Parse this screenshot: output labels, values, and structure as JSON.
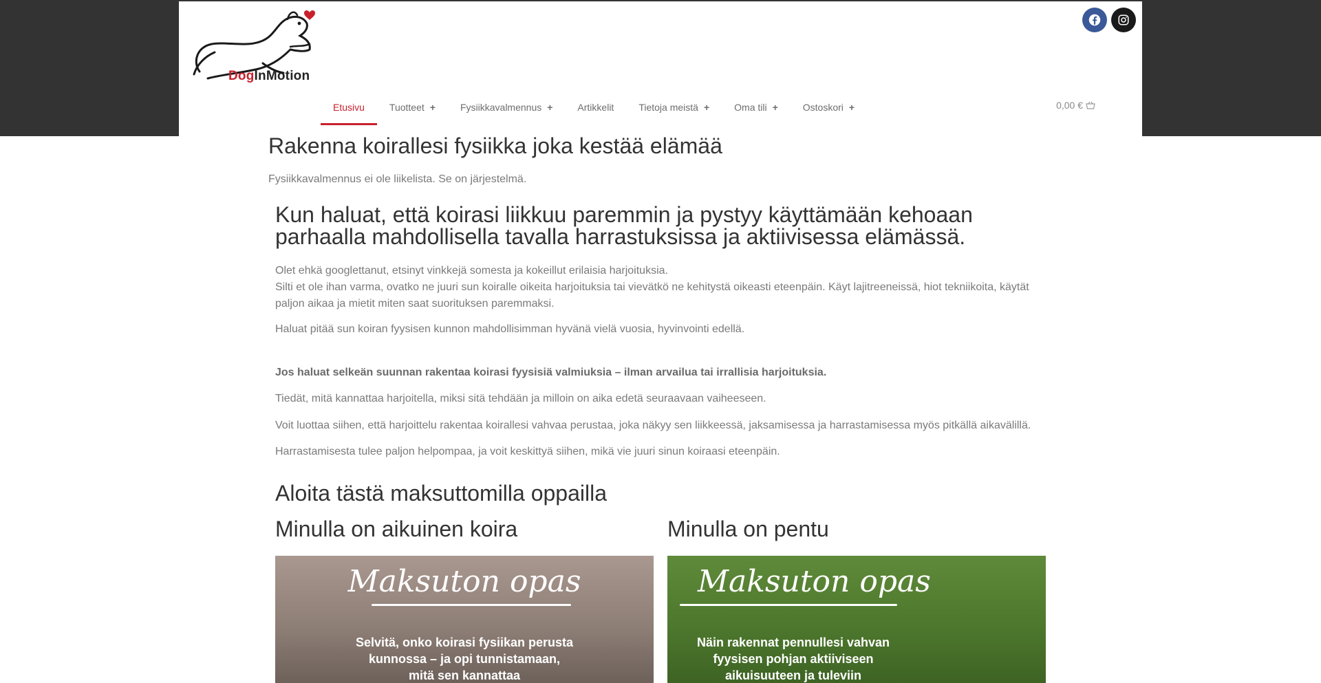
{
  "header": {
    "logo": {
      "text_dog": "Dog",
      "text_in": "In",
      "text_motion": "Motion"
    },
    "social": [
      {
        "name": "facebook-icon",
        "color": "#3b5998"
      },
      {
        "name": "instagram-icon",
        "color": "#1a1a1a"
      }
    ],
    "nav": [
      {
        "label": "Etusivu",
        "active": true,
        "has_sub": false
      },
      {
        "label": "Tuotteet",
        "has_sub": true
      },
      {
        "label": "Fysiikkavalmennus",
        "has_sub": true
      },
      {
        "label": "Artikkelit",
        "has_sub": false
      },
      {
        "label": "Tietoja meistä",
        "has_sub": true
      },
      {
        "label": "Oma tili",
        "has_sub": true
      },
      {
        "label": "Ostoskori",
        "has_sub": true
      }
    ],
    "plus": "+",
    "cart": {
      "amount": "0,00 €"
    },
    "accent": "#c8202d"
  },
  "main": {
    "title": "Rakenna koirallesi fysiikka joka kestää elämää",
    "subtitle": "Fysiikkavalmennus ei ole liikelista. Se on järjestelmä.",
    "heading": "Kun haluat, että koirasi liikkuu paremmin ja pystyy käyttämään kehoaan parhaalla mahdollisella tavalla harrastuksissa ja aktiivisessa elämässä.",
    "p1_line1": "Olet ehkä googlettanut, etsinyt vinkkejä somesta ja kokeillut erilaisia harjoituksia.",
    "p1_line2": "Silti et ole ihan varma, ovatko ne juuri sun koiralle oikeita harjoituksia tai vievätkö ne kehitystä oikeasti eteenpäin. Käyt lajitreeneissä, hiot tekniikoita, käytät paljon aikaa ja mietit miten saat suorituksen paremmaksi.",
    "p2": "Haluat pitää sun koiran fyysisen kunnon mahdollisimman hyvänä vielä vuosia, hyvinvointi edellä.",
    "p3_bold": "Jos haluat selkeän suunnan rakentaa koirasi fyysisiä valmiuksia – ilman arvailua tai irrallisia harjoituksia.",
    "p4": "Tiedät, mitä kannattaa harjoitella, miksi sitä tehdään ja milloin on aika edetä seuraavaan vaiheeseen.",
    "p5": "Voit luottaa siihen, että harjoittelu rakentaa koirallesi vahvaa perustaa, joka näkyy sen liikkeessä, jaksamisessa ja harrastamisessa myös pitkällä aikavälillä.",
    "p6": "Harrastamisesta tulee paljon helpompaa,  ja voit keskittyä siihen, mikä vie juuri sinun koiraasi eteenpäin.",
    "guides_heading": "Aloita tästä maksuttomilla oppailla",
    "guide_adult": {
      "heading": "Minulla on aikuinen koira",
      "script": "Maksuton opas",
      "text": "Selvitä, onko koirasi fysiikan perusta kunnossa – ja opi tunnistamaan, mitä sen kannattaa"
    },
    "guide_puppy": {
      "heading": "Minulla on pentu",
      "script": "Maksuton opas",
      "text": "Näin rakennat pennullesi vahvan fyysisen pohjan aktiiviseen aikuisuuteen ja tuleviin harrastuksiin"
    }
  }
}
